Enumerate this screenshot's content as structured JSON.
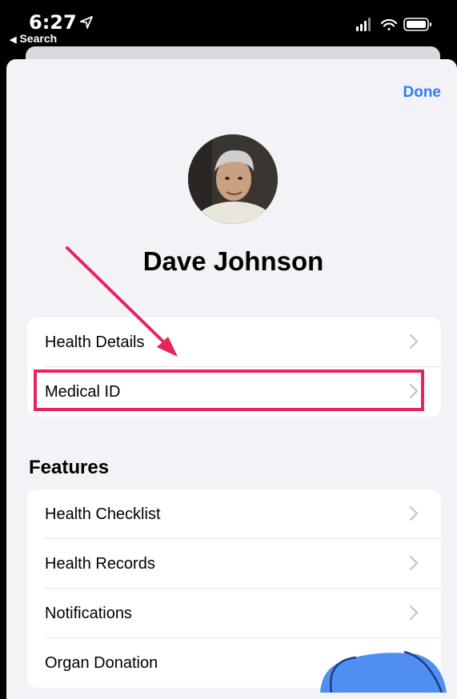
{
  "status_bar": {
    "time": "6:27",
    "back_label": "Search"
  },
  "header": {
    "done_label": "Done"
  },
  "profile": {
    "name": "Dave Johnson"
  },
  "health_section": {
    "items": [
      {
        "label": "Health Details"
      },
      {
        "label": "Medical ID"
      }
    ]
  },
  "features_section": {
    "title": "Features",
    "items": [
      {
        "label": "Health Checklist"
      },
      {
        "label": "Health Records"
      },
      {
        "label": "Notifications"
      },
      {
        "label": "Organ Donation"
      }
    ]
  },
  "colors": {
    "accent": "#2f7cf6",
    "annotation": "#e6245e",
    "background": "#f2f2f7",
    "circle_annotation": "#4f8ff0"
  }
}
